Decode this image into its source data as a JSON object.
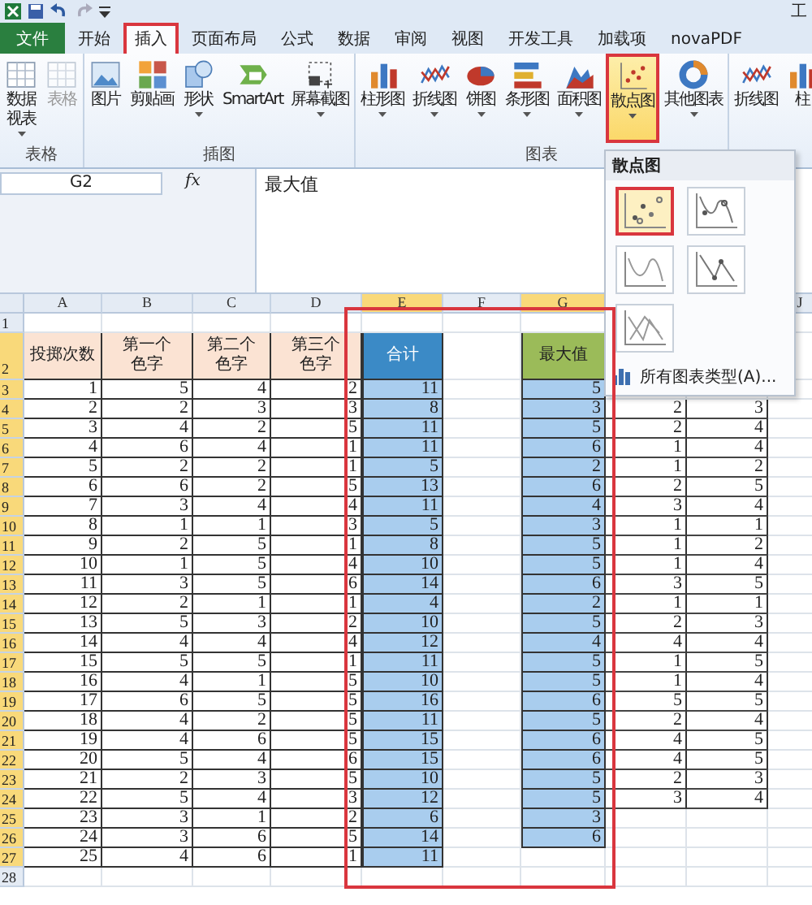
{
  "window": {
    "title": "工"
  },
  "tabs": [
    {
      "label": "文件",
      "selected": false,
      "kind": "file"
    },
    {
      "label": "开始",
      "selected": false,
      "kind": "tab"
    },
    {
      "label": "插入",
      "selected": true,
      "kind": "tab"
    },
    {
      "label": "页面布局",
      "selected": false,
      "kind": "tab"
    },
    {
      "label": "公式",
      "selected": false,
      "kind": "tab"
    },
    {
      "label": "数据",
      "selected": false,
      "kind": "tab"
    },
    {
      "label": "审阅",
      "selected": false,
      "kind": "tab"
    },
    {
      "label": "视图",
      "selected": false,
      "kind": "tab"
    },
    {
      "label": "开发工具",
      "selected": false,
      "kind": "tab"
    },
    {
      "label": "加载项",
      "selected": false,
      "kind": "tab"
    },
    {
      "label": "novaPDF",
      "selected": false,
      "kind": "tab"
    }
  ],
  "ribbon": {
    "groups": [
      {
        "label": "表格",
        "buttons": [
          {
            "lines": [
              "数据",
              "视表"
            ],
            "menu": true,
            "disabled": false
          },
          {
            "lines": [
              "表格"
            ],
            "menu": false,
            "disabled": true
          }
        ]
      },
      {
        "label": "插图",
        "buttons": [
          {
            "lines": [
              "图片"
            ],
            "menu": false,
            "disabled": false
          },
          {
            "lines": [
              "剪贴画"
            ],
            "menu": false,
            "disabled": false
          },
          {
            "lines": [
              "形状"
            ],
            "menu": true,
            "disabled": false
          },
          {
            "lines": [
              "SmartArt"
            ],
            "menu": false,
            "disabled": false
          },
          {
            "lines": [
              "屏幕截图"
            ],
            "menu": true,
            "disabled": false
          }
        ]
      },
      {
        "label": "图表",
        "buttons": [
          {
            "lines": [
              "柱形图"
            ],
            "menu": true,
            "disabled": false
          },
          {
            "lines": [
              "折线图"
            ],
            "menu": true,
            "disabled": false
          },
          {
            "lines": [
              "饼图"
            ],
            "menu": true,
            "disabled": false
          },
          {
            "lines": [
              "条形图"
            ],
            "menu": true,
            "disabled": false
          },
          {
            "lines": [
              "面积图"
            ],
            "menu": true,
            "disabled": false
          },
          {
            "lines": [
              "散点图"
            ],
            "menu": true,
            "disabled": false,
            "selected": true
          },
          {
            "lines": [
              "其他图表"
            ],
            "menu": true,
            "disabled": false
          }
        ]
      },
      {
        "buttons": [
          {
            "lines": [
              "折线图"
            ],
            "menu": false,
            "disabled": false
          },
          {
            "lines": [
              "柱"
            ],
            "menu": false,
            "disabled": false
          }
        ]
      }
    ]
  },
  "formula_bar": {
    "name_box": "G2",
    "function_label": "fx",
    "formula": "最大值"
  },
  "scatter_menu": {
    "title": "散点图",
    "subtypes": [
      {
        "selected": true
      },
      {
        "selected": false
      },
      {
        "selected": false
      },
      {
        "selected": false
      },
      {
        "selected": false
      }
    ],
    "more": "所有图表类型(A)..."
  },
  "columns": [
    {
      "label": "A",
      "selected": false,
      "kind": "input"
    },
    {
      "label": "B",
      "selected": false,
      "kind": "input"
    },
    {
      "label": "C",
      "selected": false,
      "kind": "input"
    },
    {
      "label": "D",
      "selected": false,
      "kind": "input"
    },
    {
      "label": "E",
      "selected": true,
      "kind": "sum"
    },
    {
      "label": "F",
      "selected": false,
      "kind": "blank"
    },
    {
      "label": "G",
      "selected": true,
      "kind": "max"
    },
    {
      "kind": "extra"
    },
    {
      "kind": "extra"
    },
    {
      "label": "J",
      "selected": false,
      "kind": "blank"
    }
  ],
  "rows": [
    {
      "number": "1",
      "selected": false
    },
    {
      "number": "2",
      "selected": true,
      "header": true,
      "cells": [
        [
          "投掷次数"
        ],
        [
          "第一个",
          "色字"
        ],
        [
          "第二个",
          "色字"
        ],
        [
          "第三个",
          "色字"
        ],
        [
          "合计"
        ],
        null,
        [
          "最大值"
        ],
        null,
        null,
        null
      ]
    },
    {
      "number": "3",
      "selected": true,
      "cells": [
        "1",
        "5",
        "4",
        "2",
        "11",
        null,
        "5",
        null,
        null,
        null
      ]
    },
    {
      "number": "4",
      "selected": true,
      "cells": [
        "2",
        "2",
        "3",
        "3",
        "8",
        null,
        "3",
        "2",
        "3",
        null
      ]
    },
    {
      "number": "5",
      "selected": true,
      "cells": [
        "3",
        "4",
        "2",
        "5",
        "11",
        null,
        "5",
        "2",
        "4",
        null
      ]
    },
    {
      "number": "6",
      "selected": true,
      "cells": [
        "4",
        "6",
        "4",
        "1",
        "11",
        null,
        "6",
        "1",
        "4",
        null
      ]
    },
    {
      "number": "7",
      "selected": true,
      "cells": [
        "5",
        "2",
        "2",
        "1",
        "5",
        null,
        "2",
        "1",
        "2",
        null
      ]
    },
    {
      "number": "8",
      "selected": true,
      "cells": [
        "6",
        "6",
        "2",
        "5",
        "13",
        null,
        "6",
        "2",
        "5",
        null
      ]
    },
    {
      "number": "9",
      "selected": true,
      "cells": [
        "7",
        "3",
        "4",
        "4",
        "11",
        null,
        "4",
        "3",
        "4",
        null
      ]
    },
    {
      "number": "10",
      "selected": true,
      "cells": [
        "8",
        "1",
        "1",
        "3",
        "5",
        null,
        "3",
        "1",
        "1",
        null
      ]
    },
    {
      "number": "11",
      "selected": true,
      "cells": [
        "9",
        "2",
        "5",
        "1",
        "8",
        null,
        "5",
        "1",
        "2",
        null
      ]
    },
    {
      "number": "12",
      "selected": true,
      "cells": [
        "10",
        "1",
        "5",
        "4",
        "10",
        null,
        "5",
        "1",
        "4",
        null
      ]
    },
    {
      "number": "13",
      "selected": true,
      "cells": [
        "11",
        "3",
        "5",
        "6",
        "14",
        null,
        "6",
        "3",
        "5",
        null
      ]
    },
    {
      "number": "14",
      "selected": true,
      "cells": [
        "12",
        "2",
        "1",
        "1",
        "4",
        null,
        "2",
        "1",
        "1",
        null
      ]
    },
    {
      "number": "15",
      "selected": true,
      "cells": [
        "13",
        "5",
        "3",
        "2",
        "10",
        null,
        "5",
        "2",
        "3",
        null
      ]
    },
    {
      "number": "16",
      "selected": true,
      "cells": [
        "14",
        "4",
        "4",
        "4",
        "12",
        null,
        "4",
        "4",
        "4",
        null
      ]
    },
    {
      "number": "17",
      "selected": true,
      "cells": [
        "15",
        "5",
        "5",
        "1",
        "11",
        null,
        "5",
        "1",
        "5",
        null
      ]
    },
    {
      "number": "18",
      "selected": true,
      "cells": [
        "16",
        "4",
        "1",
        "5",
        "10",
        null,
        "5",
        "1",
        "4",
        null
      ]
    },
    {
      "number": "19",
      "selected": true,
      "cells": [
        "17",
        "6",
        "5",
        "5",
        "16",
        null,
        "6",
        "5",
        "5",
        null
      ]
    },
    {
      "number": "20",
      "selected": true,
      "cells": [
        "18",
        "4",
        "2",
        "5",
        "11",
        null,
        "5",
        "2",
        "4",
        null
      ]
    },
    {
      "number": "21",
      "selected": true,
      "cells": [
        "19",
        "4",
        "6",
        "5",
        "15",
        null,
        "6",
        "4",
        "5",
        null
      ]
    },
    {
      "number": "22",
      "selected": true,
      "cells": [
        "20",
        "5",
        "4",
        "6",
        "15",
        null,
        "6",
        "4",
        "5",
        null
      ]
    },
    {
      "number": "23",
      "selected": true,
      "cells": [
        "21",
        "2",
        "3",
        "5",
        "10",
        null,
        "5",
        "2",
        "3",
        null
      ]
    },
    {
      "number": "24",
      "selected": true,
      "cells": [
        "22",
        "5",
        "4",
        "3",
        "12",
        null,
        "5",
        "3",
        "4",
        null
      ]
    },
    {
      "number": "25",
      "selected": true,
      "cells": [
        "23",
        "3",
        "1",
        "2",
        "6",
        null,
        "3",
        null,
        null,
        null
      ]
    },
    {
      "number": "26",
      "selected": true,
      "cells": [
        "24",
        "3",
        "6",
        "5",
        "14",
        null,
        "6",
        null,
        null,
        null
      ]
    },
    {
      "number": "27",
      "selected": true,
      "cells": [
        "25",
        "4",
        "6",
        "1",
        "11",
        null,
        null,
        null,
        null,
        null
      ]
    },
    {
      "number": "28",
      "selected": false
    }
  ]
}
